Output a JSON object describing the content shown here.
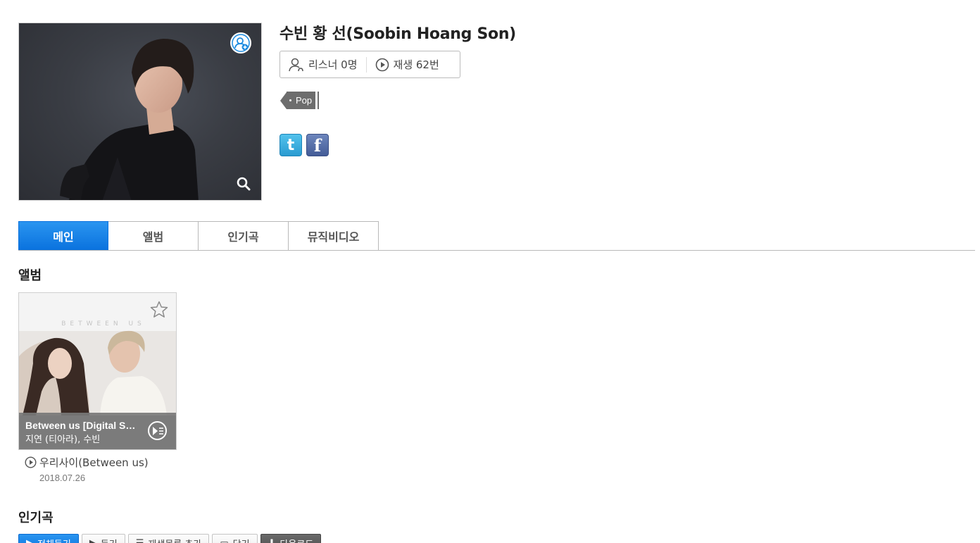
{
  "artist": {
    "name": "수빈 황 선(Soobin Hoang Son)",
    "listeners": "리스너 0명",
    "plays": "재생 62번",
    "genre": "Pop",
    "follow_icon": "add-user-icon",
    "zoom_icon": "search-icon"
  },
  "share": {
    "twitter_glyph": "t",
    "facebook_glyph": "f"
  },
  "tabs": [
    {
      "label": "메인",
      "active": true
    },
    {
      "label": "앨범",
      "active": false
    },
    {
      "label": "인기곡",
      "active": false
    },
    {
      "label": "뮤직비디오",
      "active": false
    }
  ],
  "albums_section": {
    "title": "앨범",
    "items": [
      {
        "cover_text": "BETWEEN US",
        "title": "Between us [Digital Single]",
        "artists": "지연 (티아라), 수빈",
        "name": "우리사이(Between us)",
        "date": "2018.07.26"
      }
    ]
  },
  "popular_section": {
    "title": "인기곡",
    "toolbar": {
      "play_all": "전체듣기",
      "play": "듣기",
      "add_to_playlist": "재생목록 추가",
      "save": "담기",
      "download": "다운로드"
    }
  },
  "colors": {
    "accent": "#0a72de",
    "tag_gray": "#6d6d6d",
    "twitter": "#2a9bd1",
    "facebook": "#445c97"
  }
}
